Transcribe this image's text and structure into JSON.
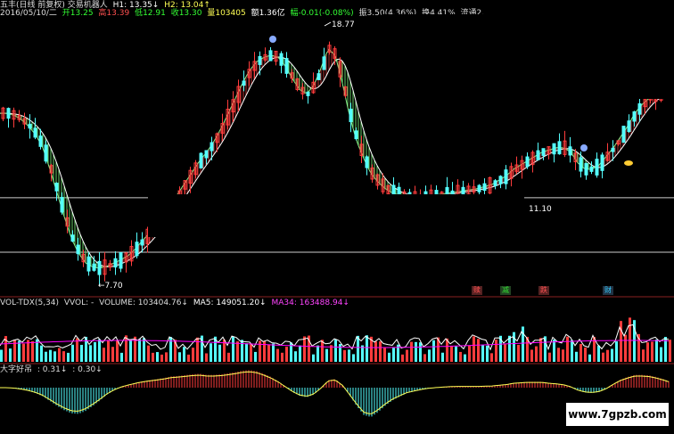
{
  "header": {
    "title": "五丰(日线 前复权) 交易机器人",
    "h1": "H1: 13.35↓",
    "h2": "H2: 13.04↑",
    "line2_date": "2016/05/10/二",
    "open": "开13.25",
    "high": "高13.39",
    "low": "低12.91",
    "close": "收13.30",
    "volume": "量103405",
    "amount": "额1.36亿",
    "change": "幅-0.01(-0.08%)",
    "amplitude": "振3.50(4.36%)",
    "turnover": "换4.41%",
    "float": "流通2."
  },
  "price_panel": {
    "high_label": "18.77",
    "low_label": "←7.70",
    "ref_label": "11.10"
  },
  "signals": [
    {
      "text": "赎",
      "color": "#ff5050"
    },
    {
      "text": "减",
      "color": "#33dd33"
    },
    {
      "text": "跌",
      "color": "#ff5050"
    },
    {
      "text": "财",
      "color": "#33ccff"
    }
  ],
  "volume_panel": {
    "label_name": "VOL-TDX(5,34)",
    "label_vvol": "VVOL: -",
    "label_volume": "VOLUME: 103404.76↓",
    "label_ma5": "MA5: 149051.20↓",
    "label_ma34": "MA34: 163488.94↓"
  },
  "indicator_panel": {
    "label_name": "大字好吊",
    "label_v1": ": 0.31↓",
    "label_v2": ": 0.30↓"
  },
  "watermark": "www.7gpzb.com",
  "colors": {
    "up": "#ff3c3c",
    "down": "#54ffff",
    "ribbon_green": "#66cc66",
    "ribbon_red": "#b03030",
    "ma5": "#ffffff",
    "ma34": "#ff00ff",
    "yellow": "#ffff55",
    "info_white": "#dddddd"
  },
  "chart_data": {
    "type": "candlestick",
    "title": "五丰(日线 前复权)",
    "ylim": [
      6.5,
      19.5
    ],
    "annotated_high": 18.77,
    "annotated_low": 7.7,
    "reference_level": 11.1,
    "close_path": [
      [
        0,
        14.9
      ],
      [
        8,
        14.9
      ],
      [
        16,
        14.8
      ],
      [
        24,
        14.6
      ],
      [
        32,
        14.3
      ],
      [
        40,
        13.9
      ],
      [
        48,
        13.3
      ],
      [
        56,
        12.3
      ],
      [
        64,
        11.2
      ],
      [
        72,
        10.1
      ],
      [
        80,
        9.1
      ],
      [
        88,
        8.4
      ],
      [
        96,
        7.95
      ],
      [
        104,
        7.75
      ],
      [
        112,
        7.7
      ],
      [
        120,
        7.8
      ],
      [
        128,
        7.95
      ],
      [
        136,
        8.1
      ],
      [
        144,
        8.3
      ],
      [
        152,
        8.6
      ],
      [
        160,
        9.0
      ],
      [
        168,
        9.35
      ],
      [
        176,
        9.7
      ],
      [
        184,
        10.1
      ],
      [
        192,
        10.7
      ],
      [
        200,
        11.2
      ],
      [
        208,
        11.7
      ],
      [
        216,
        12.2
      ],
      [
        224,
        12.7
      ],
      [
        232,
        13.1
      ],
      [
        240,
        13.6
      ],
      [
        248,
        14.2
      ],
      [
        256,
        14.9
      ],
      [
        264,
        15.6
      ],
      [
        272,
        16.3
      ],
      [
        280,
        16.9
      ],
      [
        288,
        17.3
      ],
      [
        296,
        17.5
      ],
      [
        304,
        17.6
      ],
      [
        312,
        17.5
      ],
      [
        320,
        17.1
      ],
      [
        328,
        16.5
      ],
      [
        336,
        16.0
      ],
      [
        344,
        15.8
      ],
      [
        352,
        16.2
      ],
      [
        360,
        17.0
      ],
      [
        368,
        17.9
      ],
      [
        376,
        17.6
      ],
      [
        384,
        16.3
      ],
      [
        392,
        14.8
      ],
      [
        400,
        13.6
      ],
      [
        408,
        12.8
      ],
      [
        416,
        12.1
      ],
      [
        424,
        11.7
      ],
      [
        432,
        11.4
      ],
      [
        440,
        11.2
      ],
      [
        448,
        11.1
      ],
      [
        456,
        11.05
      ],
      [
        464,
        11.0
      ],
      [
        472,
        11.0
      ],
      [
        480,
        11.05
      ],
      [
        488,
        11.1
      ],
      [
        496,
        11.15
      ],
      [
        504,
        11.2
      ],
      [
        512,
        11.25
      ],
      [
        520,
        11.3
      ],
      [
        528,
        11.35
      ],
      [
        536,
        11.4
      ],
      [
        544,
        11.5
      ],
      [
        552,
        11.6
      ],
      [
        560,
        11.8
      ],
      [
        568,
        12.0
      ],
      [
        576,
        12.3
      ],
      [
        584,
        12.5
      ],
      [
        592,
        12.7
      ],
      [
        600,
        12.9
      ],
      [
        608,
        13.1
      ],
      [
        616,
        13.2
      ],
      [
        624,
        13.3
      ],
      [
        632,
        13.3
      ],
      [
        640,
        13.1
      ],
      [
        648,
        12.6
      ],
      [
        656,
        12.3
      ],
      [
        664,
        12.3
      ],
      [
        672,
        12.5
      ],
      [
        680,
        12.9
      ],
      [
        688,
        13.3
      ],
      [
        696,
        13.8
      ],
      [
        704,
        14.3
      ],
      [
        712,
        14.9
      ],
      [
        720,
        15.3
      ],
      [
        728,
        15.6
      ],
      [
        736,
        15.8
      ],
      [
        744,
        15.9
      ],
      [
        752,
        16.0
      ]
    ],
    "volume_ma34": [
      140000,
      145000,
      150000,
      148000,
      146000,
      150000,
      155000,
      160000,
      158000,
      163489
    ]
  }
}
